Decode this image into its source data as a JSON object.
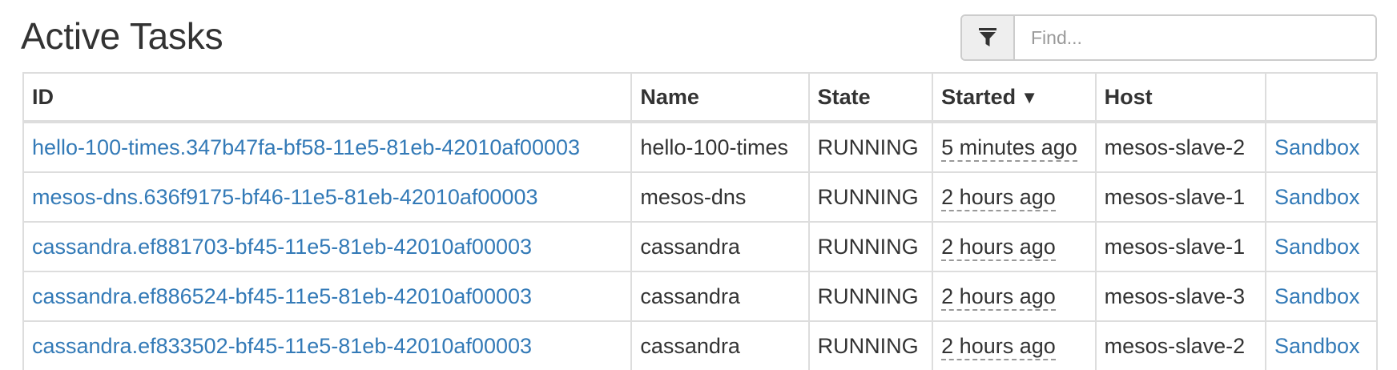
{
  "header": {
    "title": "Active Tasks"
  },
  "filter": {
    "icon": "filter-icon",
    "placeholder": "Find...",
    "value": ""
  },
  "table": {
    "columns": {
      "id": "ID",
      "name": "Name",
      "state": "State",
      "started": "Started",
      "started_sort_indicator": "▼",
      "host": "Host",
      "actions": ""
    },
    "rows": [
      {
        "id": "hello-100-times.347b47fa-bf58-11e5-81eb-42010af00003",
        "name": "hello-100-times",
        "state": "RUNNING",
        "started": "5 minutes ago",
        "host": "mesos-slave-2",
        "action": "Sandbox"
      },
      {
        "id": "mesos-dns.636f9175-bf46-11e5-81eb-42010af00003",
        "name": "mesos-dns",
        "state": "RUNNING",
        "started": "2 hours ago",
        "host": "mesos-slave-1",
        "action": "Sandbox"
      },
      {
        "id": "cassandra.ef881703-bf45-11e5-81eb-42010af00003",
        "name": "cassandra",
        "state": "RUNNING",
        "started": "2 hours ago",
        "host": "mesos-slave-1",
        "action": "Sandbox"
      },
      {
        "id": "cassandra.ef886524-bf45-11e5-81eb-42010af00003",
        "name": "cassandra",
        "state": "RUNNING",
        "started": "2 hours ago",
        "host": "mesos-slave-3",
        "action": "Sandbox"
      },
      {
        "id": "cassandra.ef833502-bf45-11e5-81eb-42010af00003",
        "name": "cassandra",
        "state": "RUNNING",
        "started": "2 hours ago",
        "host": "mesos-slave-2",
        "action": "Sandbox"
      }
    ]
  },
  "colors": {
    "link": "#337ab7",
    "text": "#333333",
    "border": "#dddddd",
    "addon_bg": "#eeeeee"
  }
}
